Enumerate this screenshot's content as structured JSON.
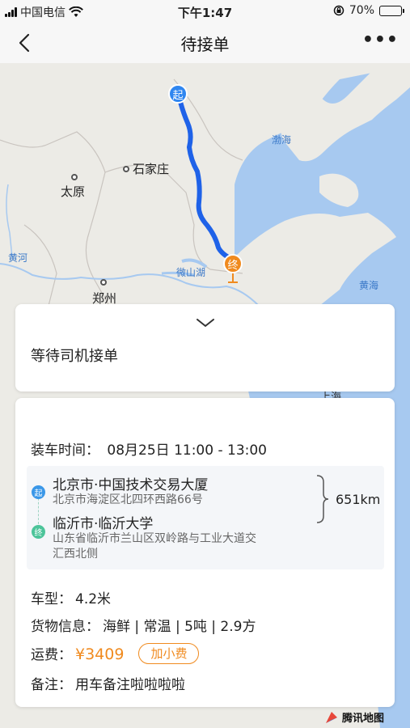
{
  "status_bar": {
    "carrier": "中国电信",
    "time": "下午1:47",
    "battery": "70%",
    "battery_level": 0.7
  },
  "nav": {
    "title": "待接单"
  },
  "map": {
    "labels": {
      "shijiazhuang": "石家庄",
      "taiyuan": "太原",
      "zhengzhou": "郑州",
      "bohai": "渤海",
      "huanghai": "黄海",
      "huanghe": "黄河",
      "weishanhu": "微山湖",
      "shanghai": "上海"
    },
    "start_pin": "起",
    "end_pin": "终",
    "provider": "腾讯地图"
  },
  "status_card": {
    "text": "等待司机接单"
  },
  "order": {
    "load_time_label": "装车时间：",
    "load_time_value": "08月25日 11:00 - 13:00",
    "start_tag": "起",
    "end_tag": "终",
    "start_title": "北京市·中国技术交易大厦",
    "start_address": "北京市海淀区北四环西路66号",
    "end_title": "临沂市·临沂大学",
    "end_address_line1": "山东省临沂市兰山区双岭路与工业大道交",
    "end_address_line2": "汇西北侧",
    "distance": "651km",
    "vehicle_label": "车型：",
    "vehicle_value": "4.2米",
    "cargo_label": "货物信息：",
    "cargo_value": "海鲜 | 常温 | 5吨 | 2.9方",
    "fee_label": "运费：",
    "fee_value": "¥3409",
    "add_tip_label": "加小费",
    "note_label": "备注：",
    "note_value": "用车备注啦啦啦啦"
  },
  "colors": {
    "accent": "#f08a1e",
    "route": "#1f62e8",
    "start": "#2f86f0",
    "end_tag": "#4cc49a"
  }
}
